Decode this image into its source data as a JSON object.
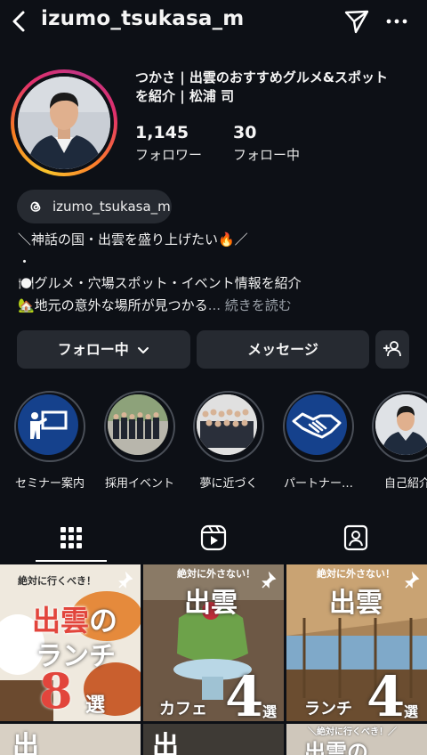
{
  "header": {
    "username": "izumo_tsukasa_m",
    "back_icon": "chevron-left-icon",
    "send_icon": "paper-plane-icon",
    "more_icon": "more-horizontal-icon"
  },
  "profile": {
    "display_name_line1": "つかさ | 出雲のおすすめグルメ&スポット",
    "display_name_line2": "を紹介 | 松浦 司",
    "followers_count": "1,145",
    "followers_label": "フォロワー",
    "following_count": "30",
    "following_label": "フォロー中",
    "threads_handle": "izumo_tsukasa_m",
    "bio": [
      "＼神話の国・出雲を盛り上げたい🔥／",
      "・",
      "🍽️グルメ・穴場スポット・イベント情報を紹介",
      "🏡地元の意外な場所が見つかる"
    ],
    "bio_more": "... 続きを読む"
  },
  "actions": {
    "following_label": "フォロー中",
    "message_label": "メッセージ",
    "add_person_icon": "add-person-icon"
  },
  "highlights": [
    {
      "label": "セミナー案内",
      "icon": "presentation-icon"
    },
    {
      "label": "採用イベント",
      "icon": "group-photo"
    },
    {
      "label": "夢に近づく",
      "icon": "group-photo"
    },
    {
      "label": "パートナー…",
      "icon": "handshake-icon"
    },
    {
      "label": "自己紹介",
      "icon": "portrait-photo"
    }
  ],
  "tabs": [
    {
      "name": "grid",
      "icon": "grid-icon",
      "active": true
    },
    {
      "name": "reels",
      "icon": "reels-icon",
      "active": false
    },
    {
      "name": "tagged",
      "icon": "tagged-person-icon",
      "active": false
    }
  ],
  "posts": [
    {
      "top": "絶対に行くべき！",
      "title_a": "出雲",
      "title_b": "の",
      "title_c": "ランチ",
      "number": "8",
      "suffix": "選",
      "pinned": true
    },
    {
      "top": "絶対に外さない！",
      "title_a": "出雲",
      "label": "カフェ",
      "number": "4",
      "suffix": "選",
      "pinned": true
    },
    {
      "top": "絶対に外さない！",
      "title_a": "出雲",
      "label": "ランチ",
      "number": "4",
      "suffix": "選",
      "pinned": true
    },
    {
      "top": "",
      "title_a": "出"
    },
    {
      "top": "",
      "title_a": "出"
    },
    {
      "top": "＼絶対に行くべき！／",
      "title_a": "出雲の"
    }
  ],
  "colors": {
    "background": "#0d1016",
    "button": "#262a31",
    "accent_red": "#e2453c",
    "highlight_blue": "#15418c"
  }
}
